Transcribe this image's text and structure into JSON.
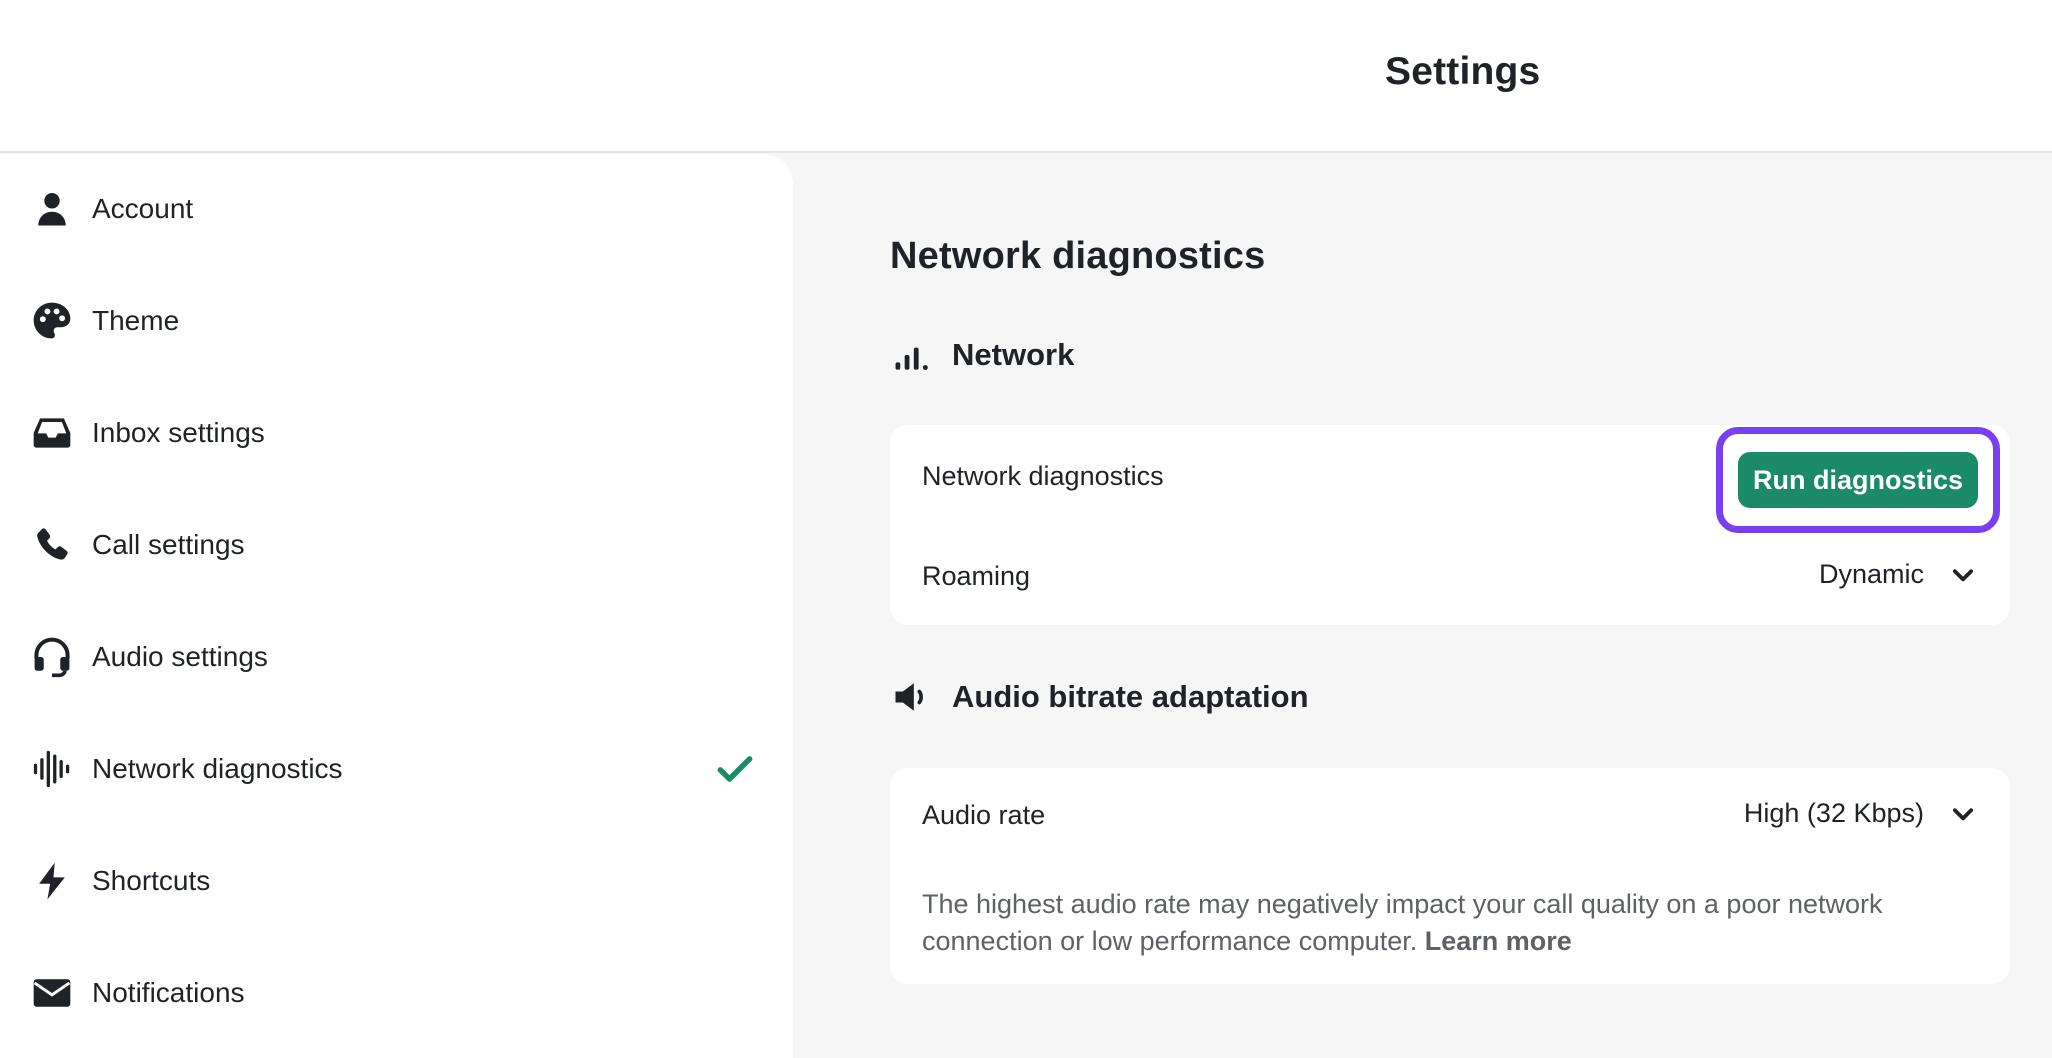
{
  "header": {
    "title": "Settings"
  },
  "sidebar": {
    "items": [
      {
        "label": "Account",
        "icon": "user-icon"
      },
      {
        "label": "Theme",
        "icon": "palette-icon"
      },
      {
        "label": "Inbox settings",
        "icon": "inbox-icon"
      },
      {
        "label": "Call settings",
        "icon": "phone-icon"
      },
      {
        "label": "Audio settings",
        "icon": "headset-icon"
      },
      {
        "label": "Network diagnostics",
        "icon": "waveform-icon",
        "active": true
      },
      {
        "label": "Shortcuts",
        "icon": "bolt-icon"
      },
      {
        "label": "Notifications",
        "icon": "envelope-icon"
      }
    ],
    "active_check_icon": "checkmark-icon"
  },
  "main": {
    "title": "Network diagnostics",
    "network": {
      "heading": "Network",
      "icon": "signal-bars-icon",
      "diagnostics_label": "Network diagnostics",
      "run_button": "Run diagnostics",
      "roaming_label": "Roaming",
      "roaming_value": "Dynamic"
    },
    "audio": {
      "heading": "Audio bitrate adaptation",
      "icon": "speaker-icon",
      "rate_label": "Audio rate",
      "rate_value": "High (32 Kbps)",
      "description": "The highest audio rate may negatively impact your call quality on a poor network connection or low performance computer. ",
      "learn_more": "Learn more"
    }
  },
  "colors": {
    "accent_green": "#1b8a66",
    "focus_ring": "#7b3ff2",
    "background": "#f6f6f6"
  }
}
